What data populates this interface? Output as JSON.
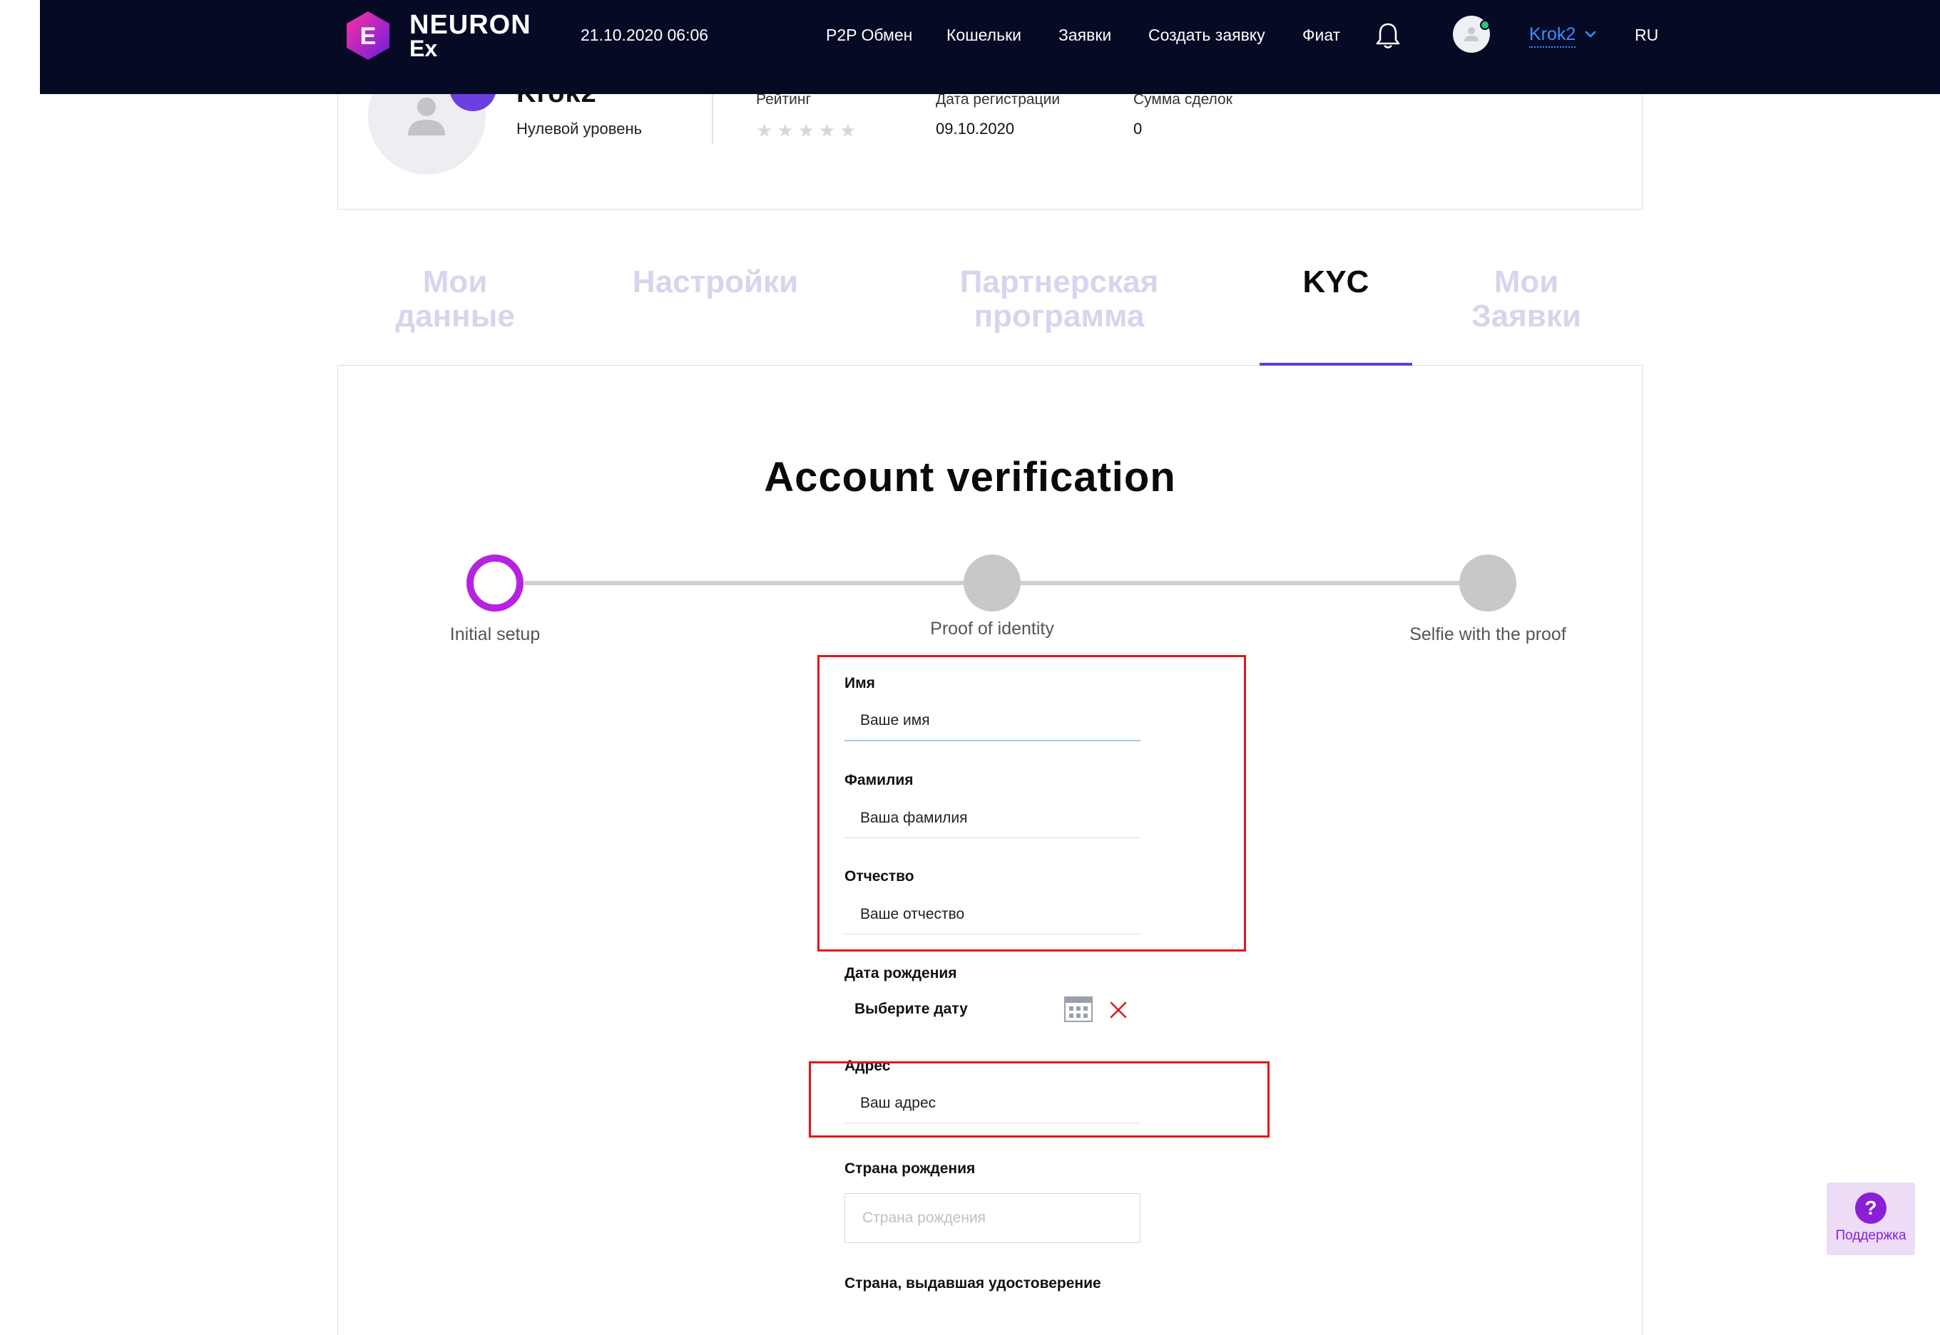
{
  "header": {
    "logo_line1": "NEURON",
    "logo_line2": "Ex",
    "logo_letter": "E",
    "datetime": "21.10.2020 06:06",
    "nav": [
      "P2P Обмен",
      "Кошельки",
      "Заявки",
      "Создать заявку",
      "Фиат"
    ],
    "user_name": "Krok2",
    "language": "RU",
    "online_status_color": "#26c281"
  },
  "profile": {
    "name": "Krok2",
    "level": "Нулевой уровень",
    "rating_label": "Рейтинг",
    "rating_stars": 0,
    "registration_label": "Дата регистрации",
    "registration_date": "09.10.2020",
    "deals_label": "Сумма сделок",
    "deals_value": "0"
  },
  "tabs": [
    {
      "line1": "Мои",
      "line2": "данные"
    },
    {
      "line1": "Настройки",
      "line2": ""
    },
    {
      "line1": "Партнерская",
      "line2": "программа"
    },
    {
      "line1": "KYC",
      "line2": "",
      "active": true
    },
    {
      "line1": "Мои",
      "line2": "Заявки"
    }
  ],
  "kyc": {
    "title": "Account verification",
    "steps": [
      "Initial setup",
      "Proof of identity",
      "Selfie with the proof"
    ],
    "active_step": 0,
    "active_color": "#b623e0"
  },
  "form": {
    "first_name_label": "Имя",
    "first_name_placeholder": "Ваше имя",
    "last_name_label": "Фамилия",
    "last_name_placeholder": "Ваша фамилия",
    "patronymic_label": "Отчество",
    "patronymic_placeholder": "Ваше отчество",
    "birth_date_label": "Дата рождения",
    "birth_date_placeholder": "Выберите дату",
    "address_label": "Адрес",
    "address_placeholder": "Ваш адрес",
    "birth_country_label": "Страна рождения",
    "birth_country_placeholder": "Страна рождения",
    "issuing_country_label": "Страна, выдавшая удостоверение"
  },
  "support": {
    "label": "Поддержка",
    "icon": "?"
  },
  "colors": {
    "header_bg": "#060a24",
    "accent_purple": "#5b40d9",
    "annotation_red": "#e8121b",
    "link_blue": "#3c8dff"
  }
}
